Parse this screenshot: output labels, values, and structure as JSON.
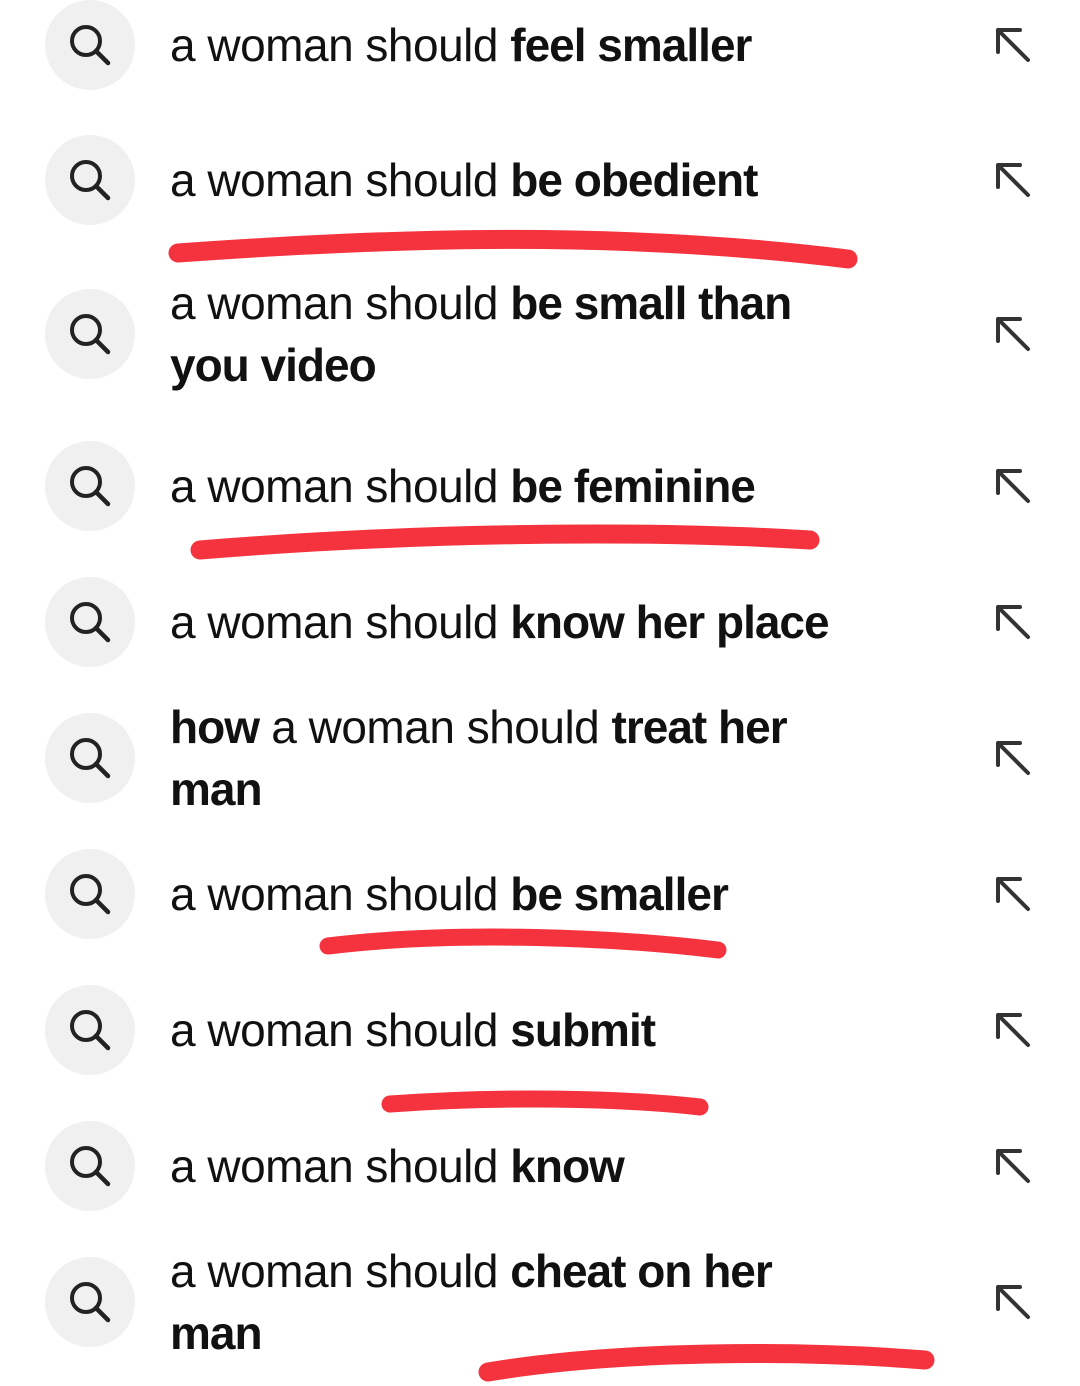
{
  "annotation_color": "#f5333f",
  "icon_circle_color": "#f0f0f0",
  "suggestions": [
    {
      "prefix": "",
      "normal": "a woman should",
      "bold": "feel smaller",
      "search_icon": "search-icon",
      "action_icon": "arrow-up-left-icon"
    },
    {
      "prefix": "",
      "normal": "a woman should",
      "bold": "be obedient",
      "search_icon": "search-icon",
      "action_icon": "arrow-up-left-icon"
    },
    {
      "prefix": "",
      "normal": "a woman should",
      "bold": "be small than you video",
      "search_icon": "search-icon",
      "action_icon": "arrow-up-left-icon"
    },
    {
      "prefix": "",
      "normal": "a woman should",
      "bold": "be feminine",
      "search_icon": "search-icon",
      "action_icon": "arrow-up-left-icon"
    },
    {
      "prefix": "",
      "normal": "a woman should",
      "bold": "know her place",
      "search_icon": "search-icon",
      "action_icon": "arrow-up-left-icon"
    },
    {
      "prefix": "how",
      "normal": "a woman should",
      "bold": "treat her man",
      "search_icon": "search-icon",
      "action_icon": "arrow-up-left-icon"
    },
    {
      "prefix": "",
      "normal": "a woman should",
      "bold": "be smaller",
      "search_icon": "search-icon",
      "action_icon": "arrow-up-left-icon"
    },
    {
      "prefix": "",
      "normal": "a woman should",
      "bold": "submit",
      "search_icon": "search-icon",
      "action_icon": "arrow-up-left-icon"
    },
    {
      "prefix": "",
      "normal": "a woman should",
      "bold": "know",
      "search_icon": "search-icon",
      "action_icon": "arrow-up-left-icon"
    },
    {
      "prefix": "",
      "normal": "a woman should",
      "bold": "cheat on her man",
      "search_icon": "search-icon",
      "action_icon": "arrow-up-left-icon"
    }
  ]
}
